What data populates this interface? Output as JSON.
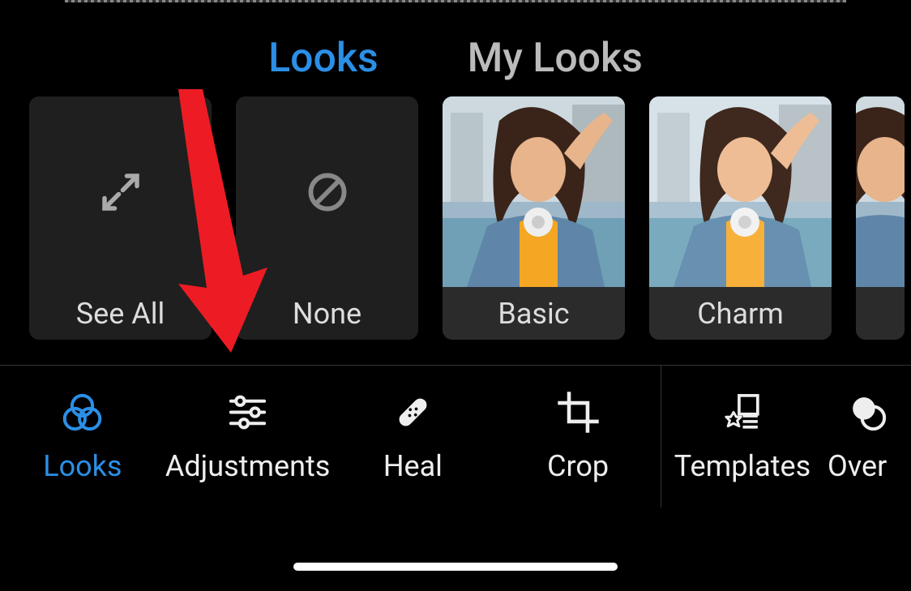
{
  "tabs": {
    "looks": "Looks",
    "my_looks": "My Looks"
  },
  "looks": {
    "see_all": "See All",
    "none": "None",
    "basic": "Basic",
    "charm": "Charm"
  },
  "toolbar": {
    "looks": "Looks",
    "adjustments": "Adjustments",
    "heal": "Heal",
    "crop": "Crop",
    "templates": "Templates",
    "overlays": "Overlays"
  },
  "colors": {
    "accent": "#2b8fe6",
    "annotation_arrow": "#ed1c24"
  },
  "icons": {
    "expand": "expand-icon",
    "none": "prohibit-icon",
    "looks_tool": "venn-icon",
    "adjustments_tool": "sliders-icon",
    "heal_tool": "bandaid-icon",
    "crop_tool": "crop-icon",
    "templates_tool": "templates-icon",
    "overlays_tool": "overlays-icon"
  }
}
